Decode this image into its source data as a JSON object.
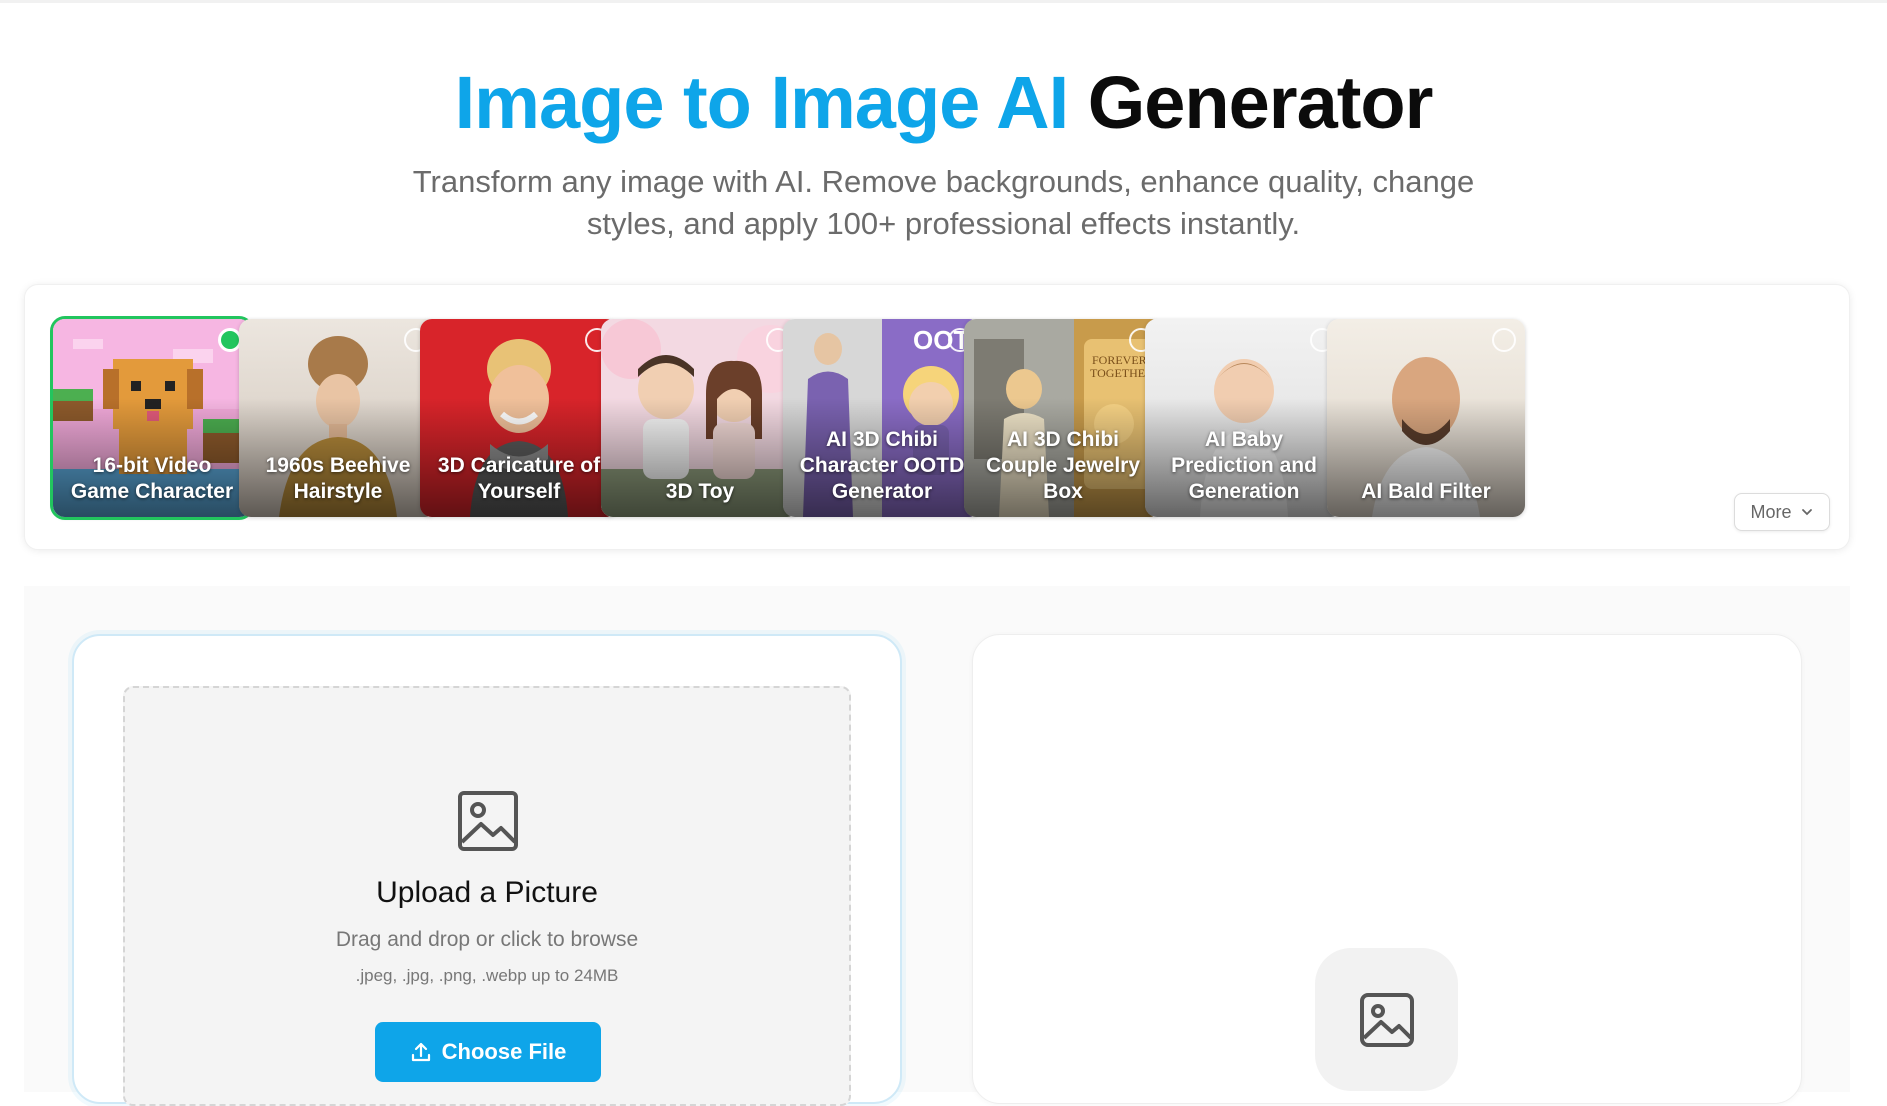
{
  "hero": {
    "title_accent": "Image to Image AI",
    "title_dark": "Generator",
    "subtitle": "Transform any image with AI. Remove backgrounds, enhance quality, change styles, and apply 100+ professional effects instantly."
  },
  "styles": {
    "selected_index": 0,
    "more_label": "More",
    "items": [
      {
        "label": "16-bit Video Game Character",
        "selected": true
      },
      {
        "label": "1960s Beehive Hairstyle",
        "selected": false
      },
      {
        "label": "3D Caricature of Yourself",
        "selected": false
      },
      {
        "label": "3D Toy",
        "selected": false
      },
      {
        "label": "AI 3D Chibi Character OOTD Generator",
        "selected": false
      },
      {
        "label": "AI 3D Chibi Couple Jewelry Box",
        "selected": false
      },
      {
        "label": "AI Baby Prediction and Generation",
        "selected": false
      },
      {
        "label": "AI Bald Filter",
        "selected": false
      }
    ]
  },
  "upload": {
    "title": "Upload a Picture",
    "subtitle": "Drag and drop or click to browse",
    "formats": ".jpeg, .jpg, .png, .webp up to 24MB",
    "button_label": "Choose File",
    "icon": "image-icon",
    "button_icon": "upload-icon"
  },
  "result": {
    "icon": "image-placeholder-icon"
  },
  "colors": {
    "accent": "#0ea5e9",
    "selected": "#22c55e"
  }
}
